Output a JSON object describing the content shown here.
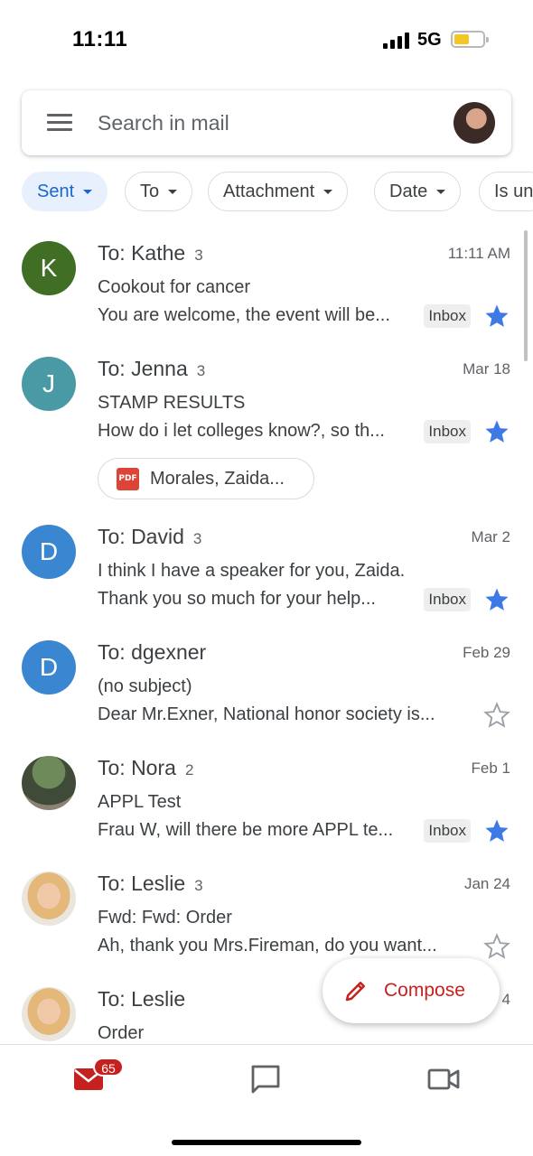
{
  "status_bar": {
    "time": "11:11",
    "network": "5G"
  },
  "search": {
    "placeholder": "Search in mail"
  },
  "filters": [
    {
      "label": "Sent",
      "active": true
    },
    {
      "label": "To",
      "active": false
    },
    {
      "label": "Attachment",
      "active": false
    },
    {
      "label": "Date",
      "active": false
    },
    {
      "label": "Is un",
      "active": false
    }
  ],
  "emails": [
    {
      "avatar": "K",
      "avatar_color": "#3f6e24",
      "to": "To: Kathe",
      "count": "3",
      "date": "11:11 AM",
      "subject": "Cookout for cancer",
      "snippet": "You are welcome, the event will be...",
      "badge": "Inbox",
      "starred": true
    },
    {
      "avatar": "J",
      "avatar_color": "#4a9aa5",
      "to": "To: Jenna",
      "count": "3",
      "date": "Mar 18",
      "subject": "STAMP RESULTS",
      "snippet": "How do i let colleges know?, so th...",
      "badge": "Inbox",
      "starred": true,
      "attachment": {
        "icon": "PDF",
        "name": "Morales, Zaida..."
      }
    },
    {
      "avatar": "D",
      "avatar_color": "#3b86d1",
      "to": "To: David",
      "count": "3",
      "date": "Mar 2",
      "subject": "I think I have a speaker for you, Zaida.",
      "snippet": "Thank you so much for your help...",
      "badge": "Inbox",
      "starred": true
    },
    {
      "avatar": "D",
      "avatar_color": "#3b86d1",
      "to": "To: dgexner",
      "count": "",
      "date": "Feb 29",
      "subject": "(no subject)",
      "snippet": "Dear Mr.Exner, National honor society is...",
      "badge": "",
      "starred": false
    },
    {
      "avatar": "",
      "avatar_color": "",
      "to": "To: Nora",
      "count": "2",
      "date": "Feb 1",
      "subject": "APPL Test",
      "snippet": "Frau W, will there be more APPL te...",
      "badge": "Inbox",
      "starred": true
    },
    {
      "avatar": "",
      "avatar_color": "",
      "to": "To: Leslie",
      "count": "3",
      "date": "Jan 24",
      "subject": "Fwd: Fwd: Order",
      "snippet": "Ah, thank you Mrs.Fireman, do you want...",
      "badge": "",
      "starred": false
    },
    {
      "avatar": "",
      "avatar_color": "",
      "to": "To: Leslie",
      "count": "",
      "date": "4",
      "subject": "Order",
      "snippet": "",
      "badge": "",
      "starred": false
    }
  ],
  "compose": {
    "label": "Compose"
  },
  "bottom_nav": {
    "mail_badge": "65"
  },
  "colors": {
    "star": "#3d7ae6",
    "accent_red": "#c5221f",
    "active_chip_bg": "#e8f0fe",
    "active_chip_text": "#1967d2"
  }
}
